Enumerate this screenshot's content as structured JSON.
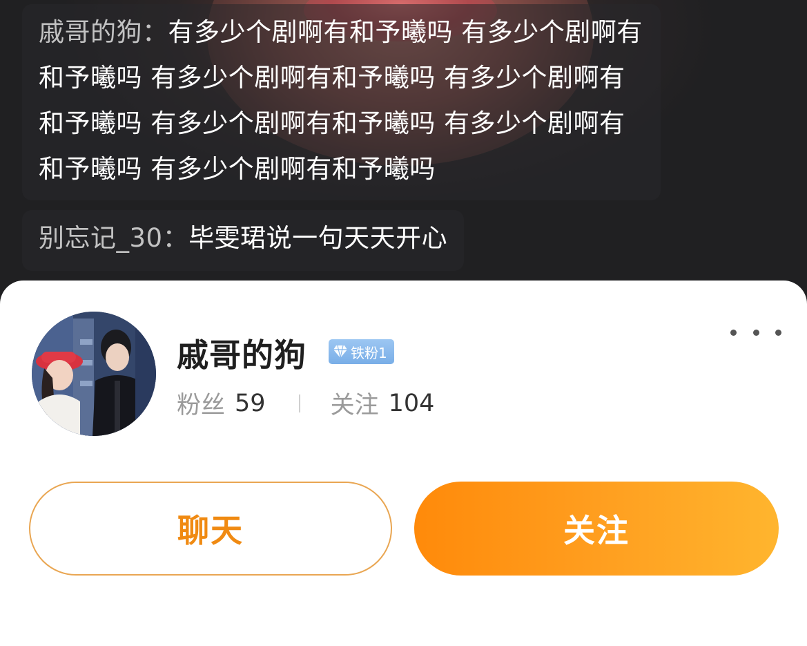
{
  "chat": {
    "comments": [
      {
        "author": "戚哥的狗：",
        "text": "有多少个剧啊有和予曦吗  有多少个剧啊有和予曦吗  有多少个剧啊有和予曦吗  有多少个剧啊有和予曦吗  有多少个剧啊有和予曦吗   有多少个剧啊有和予曦吗  有多少个剧啊有和予曦吗"
      },
      {
        "author": "别忘记_30：",
        "text": "毕雯珺说一句天天开心"
      }
    ]
  },
  "profile_card": {
    "user_name": "戚哥的狗",
    "badge": {
      "label": "铁粉1",
      "color": "#7fb3ea"
    },
    "stats": {
      "fans_label": "粉丝",
      "fans_value": "59",
      "following_label": "关注",
      "following_value": "104"
    },
    "more_icon": "more-dots-icon",
    "buttons": {
      "chat_label": "聊天",
      "follow_label": "关注"
    },
    "colors": {
      "accent": "#ff9a1a",
      "chat_text": "#f08a12"
    }
  }
}
